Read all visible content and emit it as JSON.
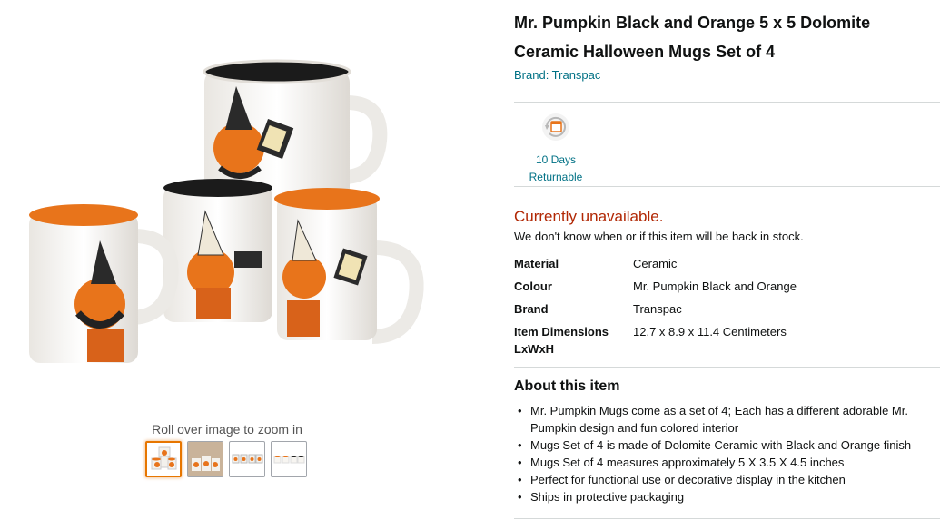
{
  "product": {
    "title": "Mr. Pumpkin Black and Orange 5 x 5 Dolomite Ceramic Halloween Mugs Set of 4",
    "brand_link": "Brand: Transpac"
  },
  "returnable": {
    "line1": "10 Days",
    "line2": "Returnable",
    "icon": "return-calendar-icon"
  },
  "availability": {
    "status": "Currently unavailable.",
    "note": "We don't know when or if this item will be back in stock."
  },
  "specs": [
    {
      "key": "Material",
      "value": "Ceramic"
    },
    {
      "key": "Colour",
      "value": "Mr. Pumpkin Black and Orange"
    },
    {
      "key": "Brand",
      "value": "Transpac"
    },
    {
      "key": "Item Dimensions LxWxH",
      "value": "12.7 x 8.9 x 11.4 Centimeters"
    }
  ],
  "about": {
    "title": "About this item",
    "bullets": [
      "Mr. Pumpkin Mugs come as a set of 4; Each has a different adorable Mr. Pumpkin design and fun colored interior",
      "Mugs Set of 4 is made of Dolomite Ceramic with Black and Orange finish",
      "Mugs Set of 4 measures approximately 5 X 3.5 X 4.5 inches",
      "Perfect for functional use or decorative display in the kitchen",
      "Ships in protective packaging"
    ]
  },
  "gallery": {
    "zoom_hint": "Roll over image to zoom in",
    "thumbnails": [
      "thumb-1",
      "thumb-2",
      "thumb-3",
      "thumb-4"
    ],
    "selected_index": 0
  },
  "colors": {
    "link": "#007185",
    "unavailable": "#b12704",
    "selected_thumb_border": "#e77600",
    "pumpkin_orange": "#e8741b"
  }
}
